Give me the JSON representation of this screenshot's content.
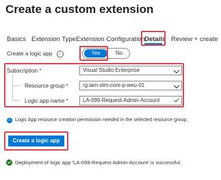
{
  "page": {
    "title": "Create a custom extension",
    "more_label": "···"
  },
  "tabs": [
    {
      "label": "Basics",
      "active": false
    },
    {
      "label": "Extension Type",
      "active": false
    },
    {
      "label": "Extension Configuration",
      "active": false
    },
    {
      "label": "Details",
      "active": true
    },
    {
      "label": "Review + create",
      "active": false
    }
  ],
  "create_logic_app": {
    "label": "Create a logic app",
    "info_glyph": "i",
    "toggle": {
      "yes": "Yes",
      "no": "No",
      "selected": "Yes"
    }
  },
  "form": {
    "subscription": {
      "label": "Subscription",
      "required_mark": "*",
      "value": "Visual Studio Enterprise"
    },
    "resource_group": {
      "label": "Resource group",
      "required_mark": "*",
      "value": "rg-iam-elm-core-p-weu-01"
    },
    "logic_app_name": {
      "label": "Logic app name",
      "required_mark": "*",
      "value": "LA-099-Request-Admin-Account"
    }
  },
  "info_message": {
    "icon": "info-icon",
    "glyph": "i",
    "text": "Logic App resource creation permission needed in the selected resource group."
  },
  "primary_button": {
    "label": "Create a logic app"
  },
  "success_message": {
    "icon": "success-check-icon",
    "text": "Deployment of  logic app 'LA-099-Request-Admin-Account' is successful."
  },
  "colors": {
    "accent": "#0078d4",
    "highlight_box": "#e0454f",
    "success": "#107c10",
    "required": "#a4262c"
  }
}
